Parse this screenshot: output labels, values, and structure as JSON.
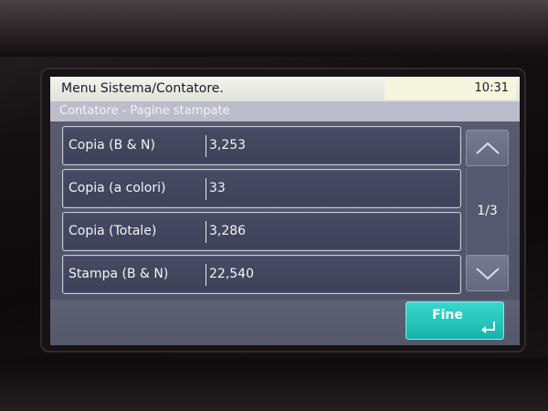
{
  "header": {
    "title": "Menu Sistema/Contatore.",
    "clock": "10:31"
  },
  "subtitle": "Contatore - Pagine stampate",
  "rows": [
    {
      "label": "Copia (B & N)",
      "value": "3,253"
    },
    {
      "label": "Copia (a colori)",
      "value": "33"
    },
    {
      "label": "Copia (Totale)",
      "value": "3,286"
    },
    {
      "label": "Stampa (B & N)",
      "value": "22,540"
    }
  ],
  "pager": {
    "indicator": "1/3",
    "up_icon": "chevron-up-icon",
    "down_icon": "chevron-down-icon"
  },
  "footer": {
    "done_label": "Fine",
    "done_icon": "enter-icon"
  },
  "colors": {
    "accent_teal": "#1fc3b9",
    "row_background": "#444660",
    "screen_background": "#56586c",
    "title_bar": "#ecece8"
  }
}
